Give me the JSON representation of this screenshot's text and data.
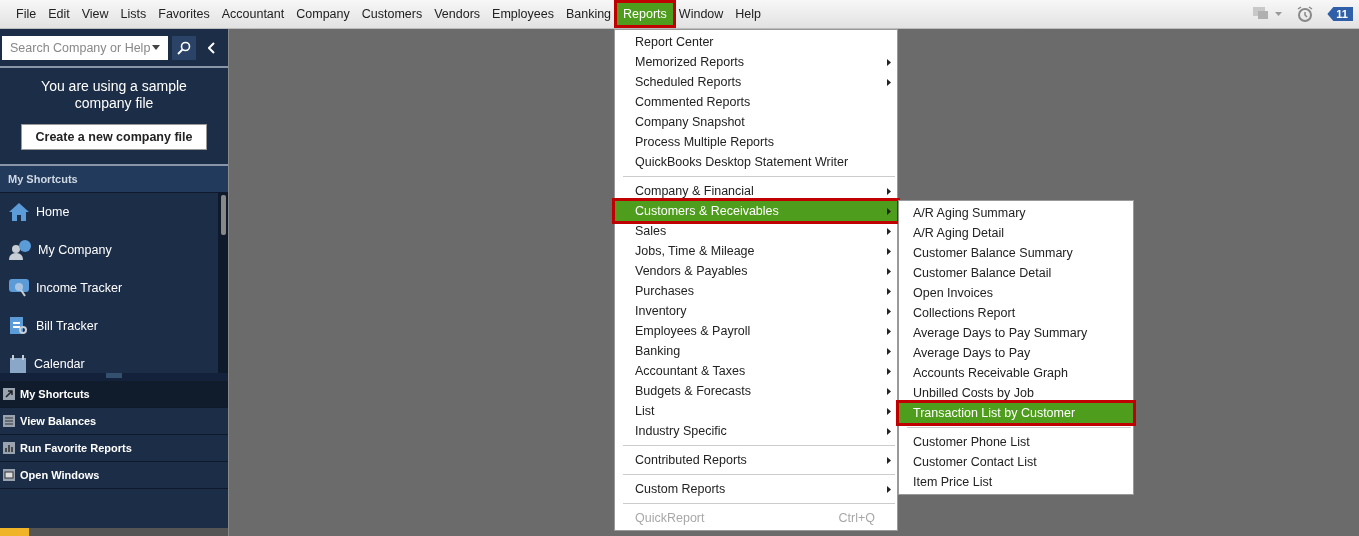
{
  "menubar": [
    {
      "label": "File",
      "selected": false
    },
    {
      "label": "Edit",
      "selected": false
    },
    {
      "label": "View",
      "selected": false
    },
    {
      "label": "Lists",
      "selected": false
    },
    {
      "label": "Favorites",
      "selected": false
    },
    {
      "label": "Accountant",
      "selected": false
    },
    {
      "label": "Company",
      "selected": false
    },
    {
      "label": "Customers",
      "selected": false
    },
    {
      "label": "Vendors",
      "selected": false
    },
    {
      "label": "Employees",
      "selected": false
    },
    {
      "label": "Banking",
      "selected": false
    },
    {
      "label": "Reports",
      "selected": true
    },
    {
      "label": "Window",
      "selected": false
    },
    {
      "label": "Help",
      "selected": false
    }
  ],
  "reminders_badge": "11",
  "sidebar": {
    "search": {
      "placeholder": "Search Company or Help"
    },
    "notice": "You are using a sample company file",
    "create_button": "Create a new company file",
    "shortcuts_header": "My Shortcuts",
    "shortcuts": [
      "Home",
      "My Company",
      "Income Tracker",
      "Bill Tracker",
      "Calendar"
    ],
    "sections": [
      {
        "label": "My Shortcuts",
        "selected": true
      },
      {
        "label": "View Balances",
        "selected": false
      },
      {
        "label": "Run Favorite Reports",
        "selected": false
      },
      {
        "label": "Open Windows",
        "selected": false
      }
    ]
  },
  "reports_menu": {
    "groups": [
      [
        {
          "label": "Report Center",
          "submenu": false,
          "selected": false,
          "disabled": false
        },
        {
          "label": "Memorized Reports",
          "submenu": true,
          "selected": false,
          "disabled": false
        },
        {
          "label": "Scheduled Reports",
          "submenu": true,
          "selected": false,
          "disabled": false
        },
        {
          "label": "Commented Reports",
          "submenu": false,
          "selected": false,
          "disabled": false
        },
        {
          "label": "Company Snapshot",
          "submenu": false,
          "selected": false,
          "disabled": false
        },
        {
          "label": "Process Multiple Reports",
          "submenu": false,
          "selected": false,
          "disabled": false
        },
        {
          "label": "QuickBooks Desktop Statement Writer",
          "submenu": false,
          "selected": false,
          "disabled": false
        }
      ],
      [
        {
          "label": "Company & Financial",
          "submenu": true,
          "selected": false,
          "disabled": false
        },
        {
          "label": "Customers & Receivables",
          "submenu": true,
          "selected": true,
          "disabled": false
        },
        {
          "label": "Sales",
          "submenu": true,
          "selected": false,
          "disabled": false
        },
        {
          "label": "Jobs, Time & Mileage",
          "submenu": true,
          "selected": false,
          "disabled": false
        },
        {
          "label": "Vendors & Payables",
          "submenu": true,
          "selected": false,
          "disabled": false
        },
        {
          "label": "Purchases",
          "submenu": true,
          "selected": false,
          "disabled": false
        },
        {
          "label": "Inventory",
          "submenu": true,
          "selected": false,
          "disabled": false
        },
        {
          "label": "Employees & Payroll",
          "submenu": true,
          "selected": false,
          "disabled": false
        },
        {
          "label": "Banking",
          "submenu": true,
          "selected": false,
          "disabled": false
        },
        {
          "label": "Accountant & Taxes",
          "submenu": true,
          "selected": false,
          "disabled": false
        },
        {
          "label": "Budgets & Forecasts",
          "submenu": true,
          "selected": false,
          "disabled": false
        },
        {
          "label": "List",
          "submenu": true,
          "selected": false,
          "disabled": false
        },
        {
          "label": "Industry Specific",
          "submenu": true,
          "selected": false,
          "disabled": false
        }
      ],
      [
        {
          "label": "Contributed Reports",
          "submenu": true,
          "selected": false,
          "disabled": false
        }
      ],
      [
        {
          "label": "Custom Reports",
          "submenu": true,
          "selected": false,
          "disabled": false
        }
      ],
      [
        {
          "label": "QuickReport",
          "submenu": false,
          "selected": false,
          "disabled": true,
          "shortcut": "Ctrl+Q"
        }
      ]
    ]
  },
  "customers_submenu": {
    "groups": [
      [
        {
          "label": "A/R Aging Summary",
          "selected": false
        },
        {
          "label": "A/R Aging Detail",
          "selected": false
        },
        {
          "label": "Customer Balance Summary",
          "selected": false
        },
        {
          "label": "Customer Balance Detail",
          "selected": false
        },
        {
          "label": "Open Invoices",
          "selected": false
        },
        {
          "label": "Collections Report",
          "selected": false
        },
        {
          "label": "Average Days to Pay Summary",
          "selected": false
        },
        {
          "label": "Average Days to Pay",
          "selected": false
        },
        {
          "label": "Accounts Receivable Graph",
          "selected": false
        },
        {
          "label": "Unbilled Costs by Job",
          "selected": false
        },
        {
          "label": "Transaction List by Customer",
          "selected": true
        }
      ],
      [
        {
          "label": "Customer Phone List",
          "selected": false
        },
        {
          "label": "Customer Contact List",
          "selected": false
        },
        {
          "label": "Item Price List",
          "selected": false
        }
      ]
    ]
  }
}
